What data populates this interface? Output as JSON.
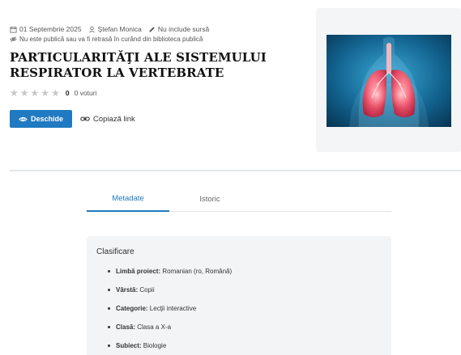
{
  "meta": {
    "date": "01 Septembrie 2025",
    "author": "Ştefan Monica",
    "source_note": "Nu include sursă",
    "visibility_note": "Nu este publică sau va fi retrasă în curând din biblioteca publică"
  },
  "title": "PARTICULARITĂŢI ALE SISTEMULUI RESPIRATOR LA VERTEBRATE",
  "rating": {
    "value": 0,
    "max": 5,
    "count": "0",
    "label": "0 voturi"
  },
  "actions": {
    "open_label": "Deschide",
    "copy_label": "Copiază link"
  },
  "tabs": [
    {
      "label": "Metadate",
      "active": true
    },
    {
      "label": "Istoric",
      "active": false
    }
  ],
  "classification": {
    "title": "Clasificare",
    "items": [
      {
        "label": "Limbă proiect:",
        "value": "Romanian (ro, Română)"
      },
      {
        "label": "Vârstă:",
        "value": "Copii"
      },
      {
        "label": "Categorie:",
        "value": "Lecţii interactive"
      },
      {
        "label": "Clasă:",
        "value": "Clasa a X-a"
      },
      {
        "label": "Subiect:",
        "value": "Biologie"
      }
    ]
  },
  "colors": {
    "accent": "#1f7ac1",
    "star_empty": "#c7c7c7",
    "panel_bg": "#f3f4f6"
  }
}
